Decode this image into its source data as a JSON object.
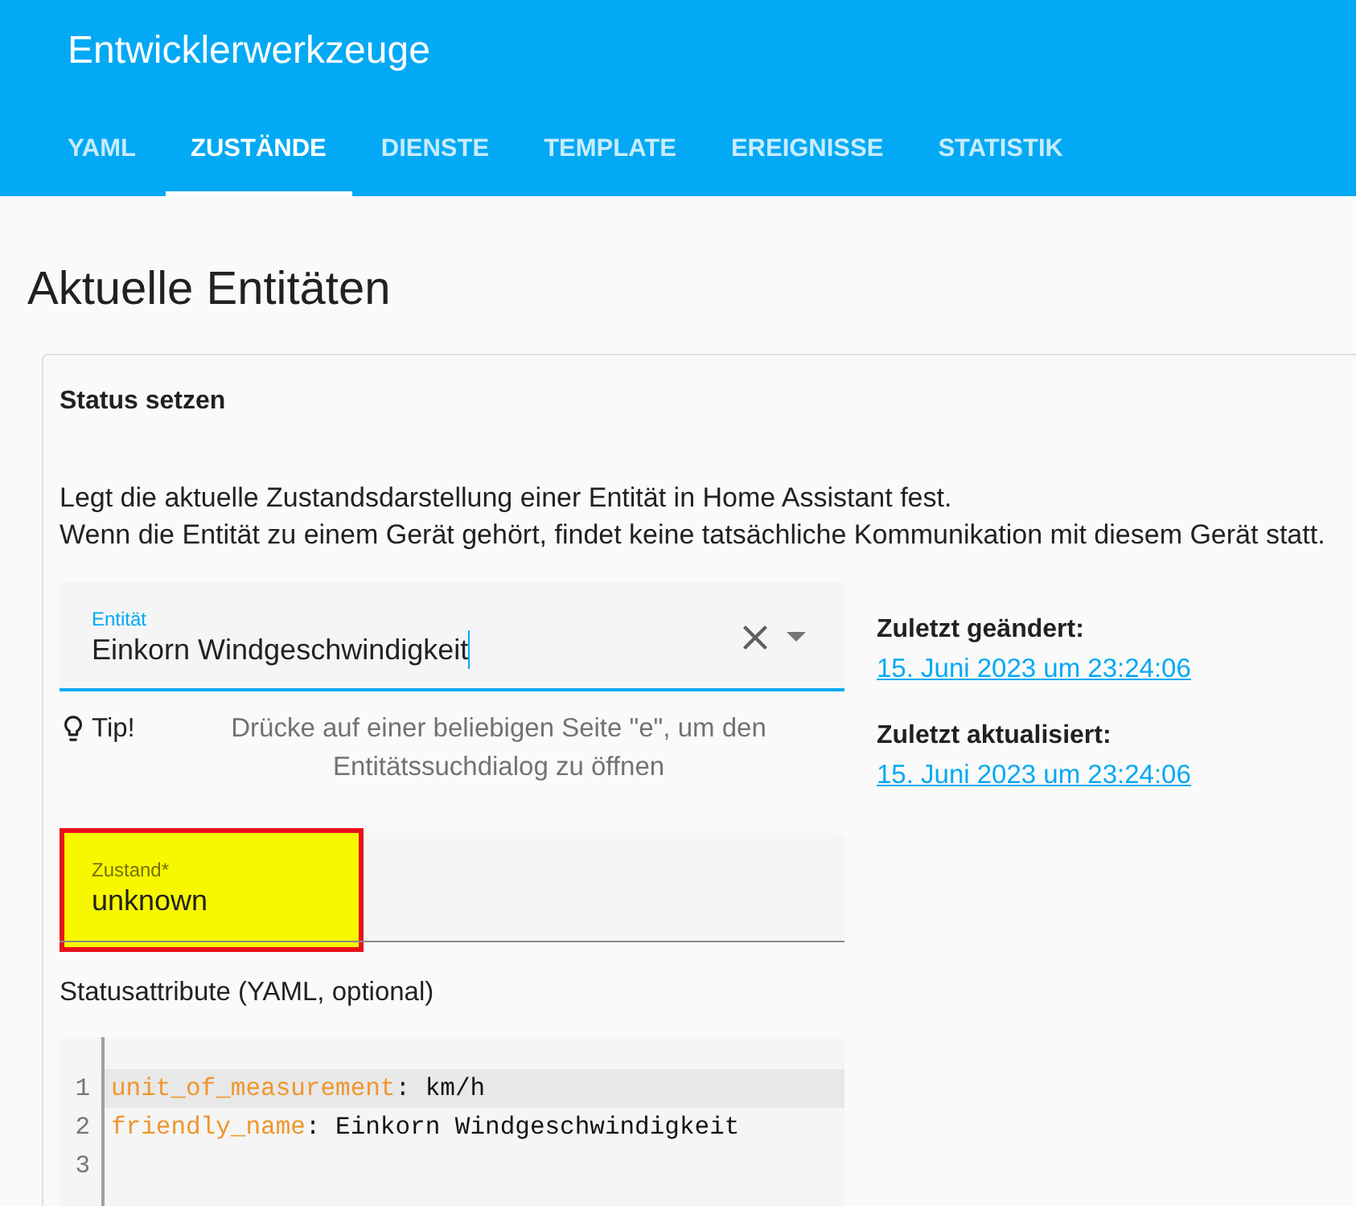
{
  "header": {
    "title": "Entwicklerwerkzeuge",
    "tabs": [
      {
        "label": "YAML",
        "selected": false
      },
      {
        "label": "ZUSTÄNDE",
        "selected": true
      },
      {
        "label": "DIENSTE",
        "selected": false
      },
      {
        "label": "TEMPLATE",
        "selected": false
      },
      {
        "label": "EREIGNISSE",
        "selected": false
      },
      {
        "label": "STATISTIK",
        "selected": false
      }
    ]
  },
  "page_title": "Aktuelle Entitäten",
  "card": {
    "title": "Status setzen",
    "description": [
      "Legt die aktuelle Zustandsdarstellung einer Entität in Home Assistant fest.",
      "Wenn die Entität zu einem Gerät gehört, findet keine tatsächliche Kommunikation mit diesem Gerät statt."
    ],
    "entity_field": {
      "kind": "combobox",
      "label": "Entität",
      "value": "Einkorn Windgeschwindigkeit",
      "focused": true
    },
    "tip": {
      "label": "Tip!",
      "text": "Drücke auf einer beliebigen Seite \"e\", um den Entitätssuchdialog zu öffnen"
    },
    "state_field": {
      "kind": "text",
      "label": "Zustand*",
      "value": "unknown",
      "focused": false,
      "highlighted": true
    },
    "attributes_label": "Statusattribute (YAML, optional)",
    "code_editor": {
      "lines": [
        {
          "number": "1",
          "active": true,
          "tokens": [
            {
              "kind": "key",
              "text": "unit_of_measurement"
            },
            {
              "kind": "text",
              "text": ": km/h"
            }
          ]
        },
        {
          "number": "2",
          "active": false,
          "tokens": [
            {
              "kind": "key",
              "text": "friendly_name"
            },
            {
              "kind": "text",
              "text": ": Einkorn Windgeschwindigkeit"
            }
          ]
        },
        {
          "number": "3",
          "active": false
        }
      ]
    },
    "info": [
      {
        "label": "Zuletzt geändert:",
        "value": "15. Juni 2023 um 23:24:06"
      },
      {
        "label": "Zuletzt aktualisiert:",
        "value": "15. Juni 2023 um 23:24:06"
      }
    ]
  }
}
